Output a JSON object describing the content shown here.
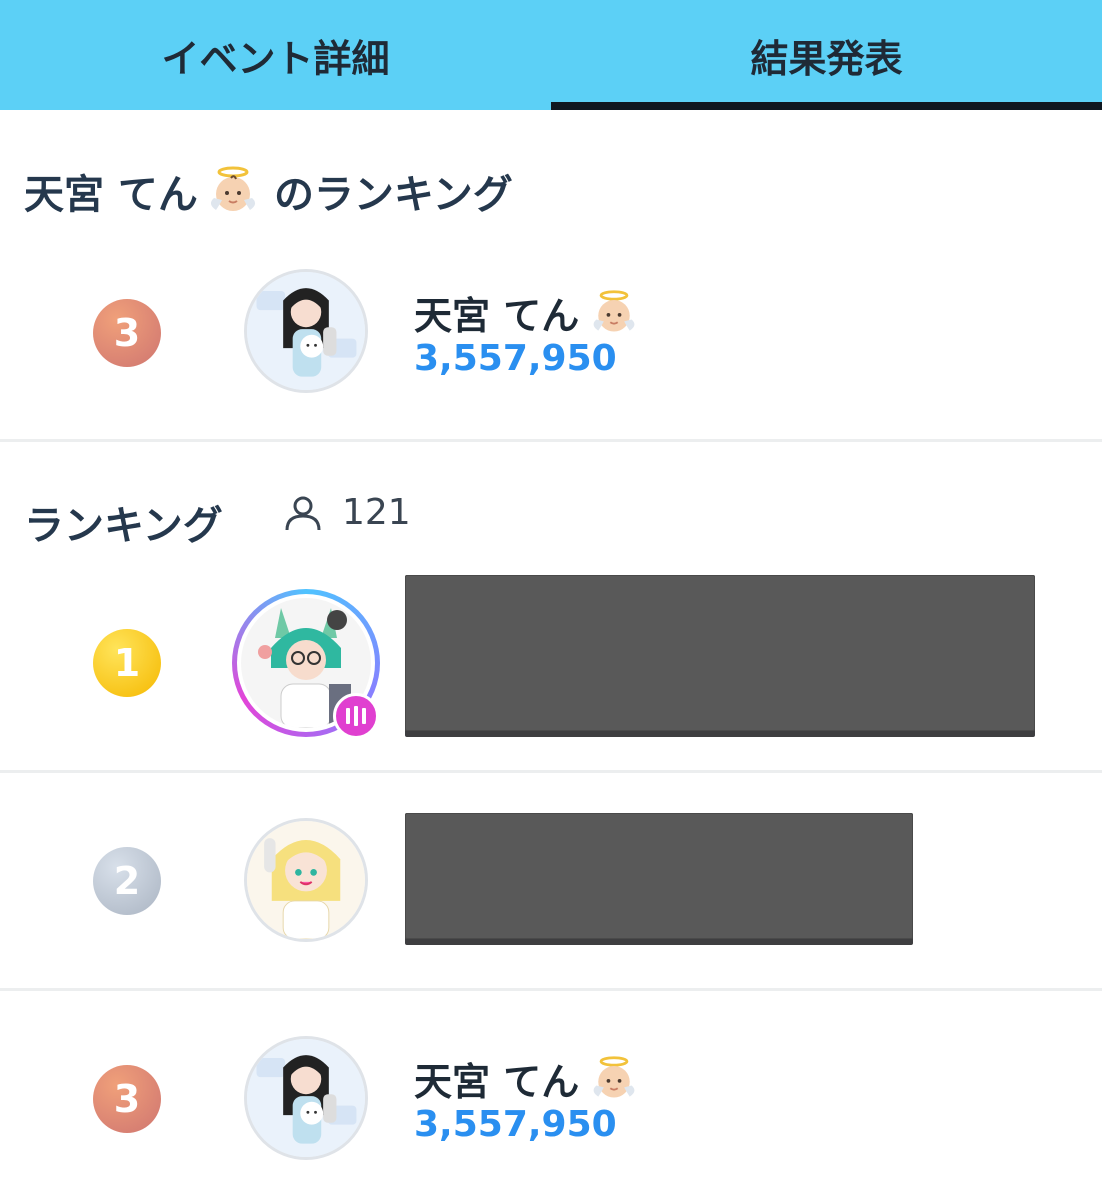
{
  "tabs": [
    {
      "label": "イベント詳細",
      "active": false
    },
    {
      "label": "結果発表",
      "active": true
    }
  ],
  "my_ranking": {
    "title_name": "天宮 てん",
    "title_suffix": "のランキング",
    "title_emoji": "baby-angel-emoji",
    "rank": "3",
    "user_name": "天宮 てん",
    "score": "3,557,950"
  },
  "ranking": {
    "title": "ランキング",
    "participant_count": "121",
    "entries": [
      {
        "rank": "1",
        "name_redacted": true,
        "live": true
      },
      {
        "rank": "2",
        "name_redacted": true,
        "live": false
      },
      {
        "rank": "3",
        "name": "天宮 てん",
        "score": "3,557,950"
      }
    ]
  },
  "colors": {
    "tab_bg": "#5cd0f6",
    "score": "#2a8ff0",
    "gold": "#f5b800",
    "silver": "#aab4c2",
    "bronze": "#cf7570",
    "live": "#e040d0"
  }
}
